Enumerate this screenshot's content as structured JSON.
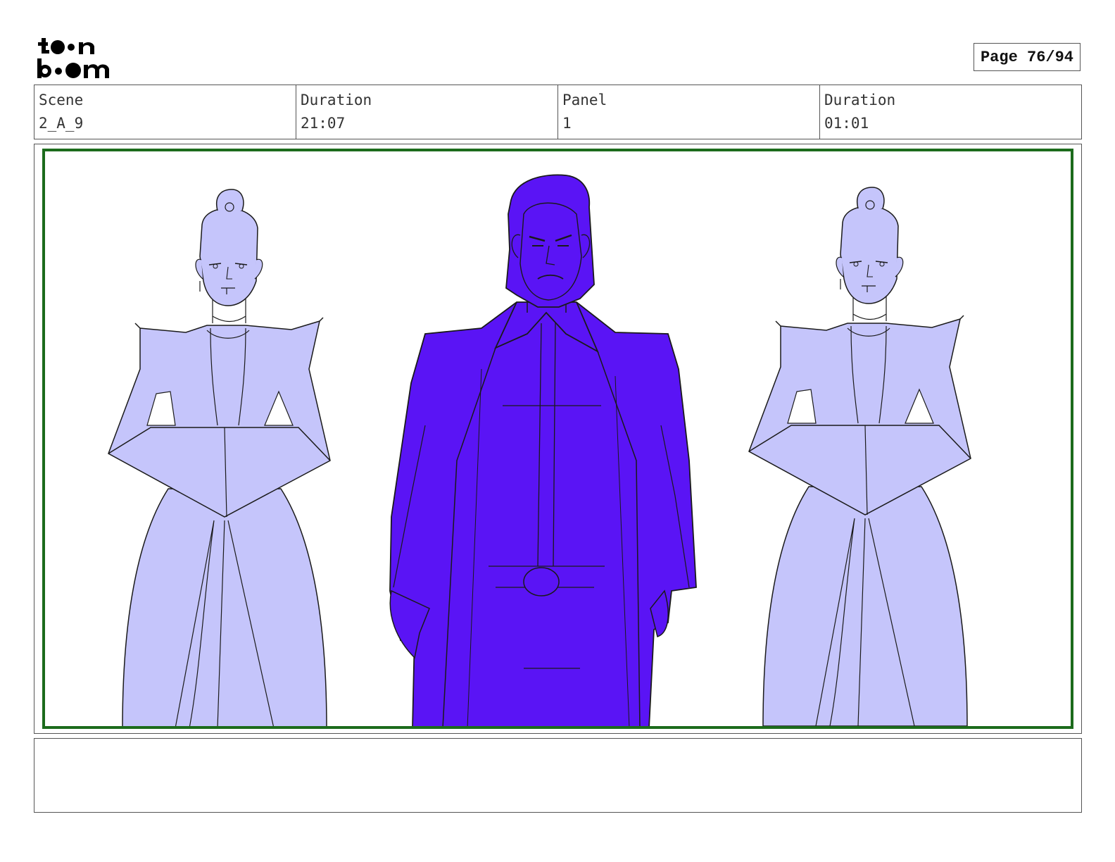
{
  "header": {
    "logo_text_top": "toon",
    "logo_text_bottom": "boom",
    "page_label": "Page 76/94"
  },
  "info": {
    "scene_label": "Scene",
    "scene_value": "2_A_9",
    "scene_duration_label": "Duration",
    "scene_duration_value": "21:07",
    "panel_label": "Panel",
    "panel_value": "1",
    "panel_duration_label": "Duration",
    "panel_duration_value": "01:01"
  },
  "colors": {
    "frame_border": "#1c6b1c",
    "side_figure_fill": "#c5c5fb",
    "center_figure_fill": "#5a14f5",
    "line": "#1a1a1a"
  },
  "notes": {
    "text": ""
  }
}
